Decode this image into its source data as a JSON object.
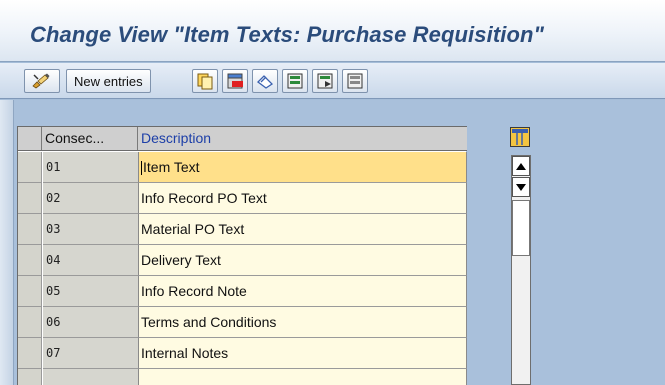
{
  "window": {
    "title": "Change View \"Item Texts: Purchase Requisition\""
  },
  "toolbar": {
    "new_entries_label": "New entries",
    "icons": [
      "display-change-icon",
      "copy-icon",
      "delete-icon",
      "undo-change-icon",
      "select-all-icon",
      "select-block-icon",
      "deselect-all-icon"
    ]
  },
  "table": {
    "columns": [
      "Consec...",
      "Description"
    ],
    "rows": [
      {
        "id": "01",
        "description": "Item Text"
      },
      {
        "id": "02",
        "description": "Info Record PO Text"
      },
      {
        "id": "03",
        "description": "Material PO Text"
      },
      {
        "id": "04",
        "description": "Delivery Text"
      },
      {
        "id": "05",
        "description": "Info Record Note"
      },
      {
        "id": "06",
        "description": "Terms and Conditions"
      },
      {
        "id": "07",
        "description": "Internal Notes"
      },
      {
        "id": "",
        "description": ""
      }
    ],
    "active_row": 0
  },
  "colors": {
    "title": "#2b4c7b",
    "header_description": "#1d3fa8",
    "active_cell": "#ffe08a",
    "cell": "#fffbe2"
  }
}
